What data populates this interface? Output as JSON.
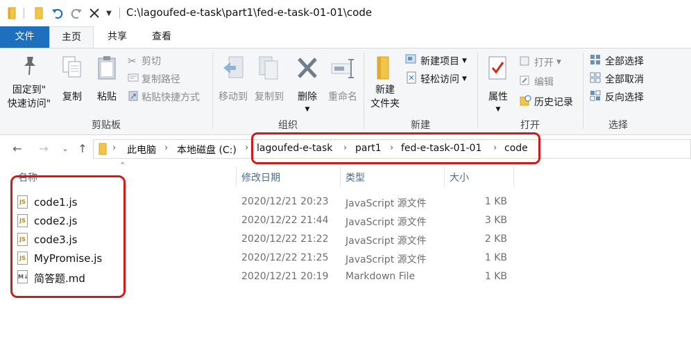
{
  "titlebar": {
    "path": "C:\\lagoufed-e-task\\part1\\fed-e-task-01-01\\code",
    "quick_access": [
      "folder-icon",
      "pin-folder-icon",
      "undo-icon",
      "redo-icon",
      "delete-icon",
      "dropdown-icon"
    ]
  },
  "tabs": {
    "file": "文件",
    "home": "主页",
    "share": "共享",
    "view": "查看"
  },
  "ribbon": {
    "clipboard": {
      "label": "剪贴板",
      "pin_line1": "固定到\"",
      "pin_line2": "快速访问\"",
      "copy": "复制",
      "paste": "粘贴",
      "cut": "剪切",
      "copy_path": "复制路径",
      "paste_shortcut": "粘贴快捷方式"
    },
    "organize": {
      "label": "组织",
      "move_to": "移动到",
      "copy_to": "复制到",
      "delete": "删除",
      "rename": "重命名"
    },
    "new": {
      "label": "新建",
      "new_folder_line1": "新建",
      "new_folder_line2": "文件夹",
      "new_item": "新建项目",
      "easy_access": "轻松访问"
    },
    "open": {
      "label": "打开",
      "properties": "属性",
      "open": "打开",
      "edit": "编辑",
      "history": "历史记录"
    },
    "select": {
      "label": "选择",
      "select_all": "全部选择",
      "select_none": "全部取消",
      "invert": "反向选择"
    }
  },
  "address": {
    "crumbs": [
      "此电脑",
      "本地磁盘 (C:)",
      "lagoufed-e-task",
      "part1",
      "fed-e-task-01-01",
      "code"
    ]
  },
  "columns": {
    "name": "名称",
    "modified": "修改日期",
    "type": "类型",
    "size": "大小"
  },
  "files": [
    {
      "name": "code1.js",
      "modified": "2020/12/21 20:23",
      "type": "JavaScript 源文件",
      "size": "1 KB",
      "icon": "js-file-icon"
    },
    {
      "name": "code2.js",
      "modified": "2020/12/22 21:44",
      "type": "JavaScript 源文件",
      "size": "3 KB",
      "icon": "js-file-icon"
    },
    {
      "name": "code3.js",
      "modified": "2020/12/22 21:22",
      "type": "JavaScript 源文件",
      "size": "2 KB",
      "icon": "js-file-icon"
    },
    {
      "name": "MyPromise.js",
      "modified": "2020/12/22 21:25",
      "type": "JavaScript 源文件",
      "size": "1 KB",
      "icon": "js-file-icon"
    },
    {
      "name": "简答题.md",
      "modified": "2020/12/21 20:19",
      "type": "Markdown File",
      "size": "1 KB",
      "icon": "markdown-file-icon"
    }
  ],
  "colors": {
    "file_tab": "#1f6fbf",
    "highlight": "#d21a1a",
    "folder": "#f3c448"
  }
}
